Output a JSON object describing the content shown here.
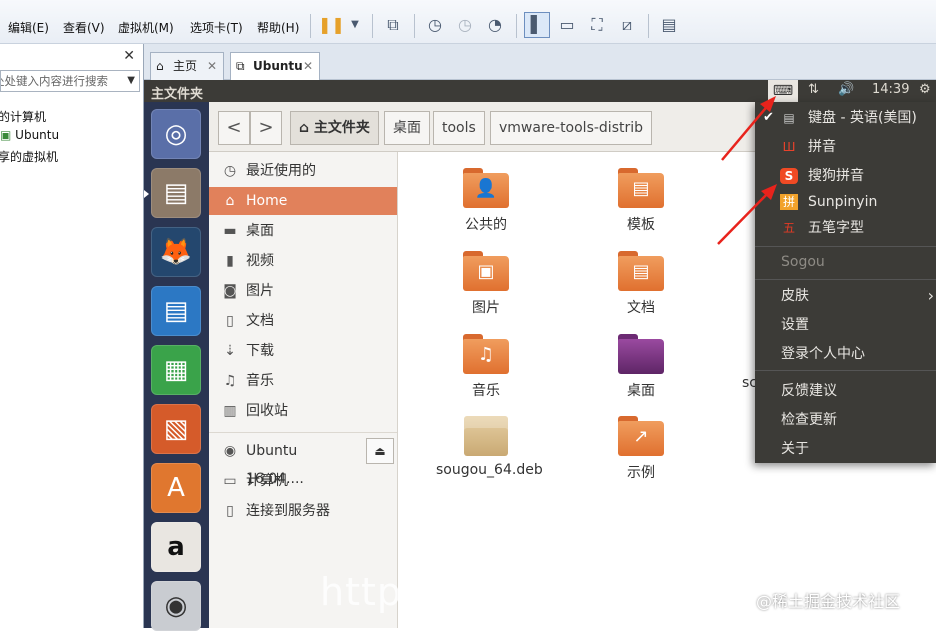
{
  "vmware": {
    "menu": [
      "编辑(E)",
      "查看(V)",
      "虚拟机(M)",
      "选项卡(T)",
      "帮助(H)"
    ],
    "toolbar_icons": [
      "pause-icon",
      "dropdown-icon",
      "send-keys-icon",
      "snapshot-icon",
      "revert-snapshot-icon",
      "snapshot-manager-icon",
      "console-view-icon",
      "fullscreen-bar-icon",
      "fullscreen-icon",
      "unity-icon",
      "library-icon"
    ],
    "library": {
      "close": "✕",
      "search_placeholder": "处处键入内容进行搜索",
      "items": [
        "的计算机",
        "Ubuntu",
        "享的虚拟机"
      ]
    },
    "tabs": [
      {
        "label": "主页",
        "icon": "home-icon",
        "close": "✕"
      },
      {
        "label": "Ubuntu",
        "icon": "vm-icon",
        "close": "✕"
      }
    ]
  },
  "ubuntu": {
    "topbar_title": "主文件夹",
    "indicators": {
      "kbd": "⌨",
      "network": "⇅",
      "volume": "🔊",
      "time": "14:39",
      "power": "⚙"
    },
    "launcher": [
      "ubuntu-dash-icon",
      "files-icon",
      "firefox-icon",
      "writer-icon",
      "calc-icon",
      "impress-icon",
      "software-center-icon",
      "amazon-icon",
      "dvd-icon"
    ],
    "nautilus": {
      "back": "<",
      "forward": ">",
      "breadcrumbs": [
        "主文件夹",
        "桌面",
        "tools",
        "vmware-tools-distrib"
      ],
      "places": [
        {
          "label": "最近使用的",
          "icon": "◷"
        },
        {
          "label": "Home",
          "icon": "⌂",
          "selected": true
        },
        {
          "label": "桌面",
          "icon": "▬"
        },
        {
          "label": "视频",
          "icon": "▮"
        },
        {
          "label": "图片",
          "icon": "◙"
        },
        {
          "label": "文档",
          "icon": "▯"
        },
        {
          "label": "下载",
          "icon": "⇣"
        },
        {
          "label": "音乐",
          "icon": "♫"
        },
        {
          "label": "回收站",
          "icon": "▥"
        }
      ],
      "devices": [
        {
          "label": "Ubuntu 16.04....",
          "icon": "◉"
        },
        {
          "label": "计算机",
          "icon": "▭"
        },
        {
          "label": "连接到服务器",
          "icon": "▯"
        }
      ],
      "eject": "⏏",
      "files": [
        {
          "label": "公共的",
          "type": "folder",
          "symbol": "👤"
        },
        {
          "label": "模板",
          "type": "folder",
          "symbol": "▤"
        },
        {
          "label": "图片",
          "type": "folder",
          "symbol": "▣"
        },
        {
          "label": "文档",
          "type": "folder",
          "symbol": "▤"
        },
        {
          "label": "音乐",
          "type": "folder",
          "symbol": "♫"
        },
        {
          "label": "桌面",
          "type": "desktop",
          "symbol": ""
        },
        {
          "label": "sougou_64.deb",
          "type": "package",
          "symbol": ""
        },
        {
          "label": "示例",
          "type": "folder",
          "symbol": "↗"
        }
      ],
      "partial_label": "sc"
    },
    "input_menu": {
      "methods": [
        {
          "label": "键盘 - 英语(美国)",
          "icon": "▤",
          "checked": true,
          "icon_color": "#cccccc"
        },
        {
          "label": "拼音",
          "icon": "Ш",
          "icon_color": "#e8422b"
        },
        {
          "label": "搜狗拼音",
          "icon": "S",
          "icon_color": "#f04a24"
        },
        {
          "label": "Sunpinyin",
          "icon": "拼",
          "icon_color": "#f2a22b"
        },
        {
          "label": "五笔字型",
          "icon": "五",
          "icon_color": "#e23b25"
        }
      ],
      "header": "Sogou",
      "options": [
        {
          "label": "皮肤",
          "submenu": true
        },
        {
          "label": "设置"
        },
        {
          "label": "登录个人中心"
        },
        {
          "label": "反馈建议"
        },
        {
          "label": "检查更新"
        },
        {
          "label": "关于"
        }
      ]
    }
  },
  "watermark": "@稀土掘金技术社区",
  "faint_overlay": "https"
}
